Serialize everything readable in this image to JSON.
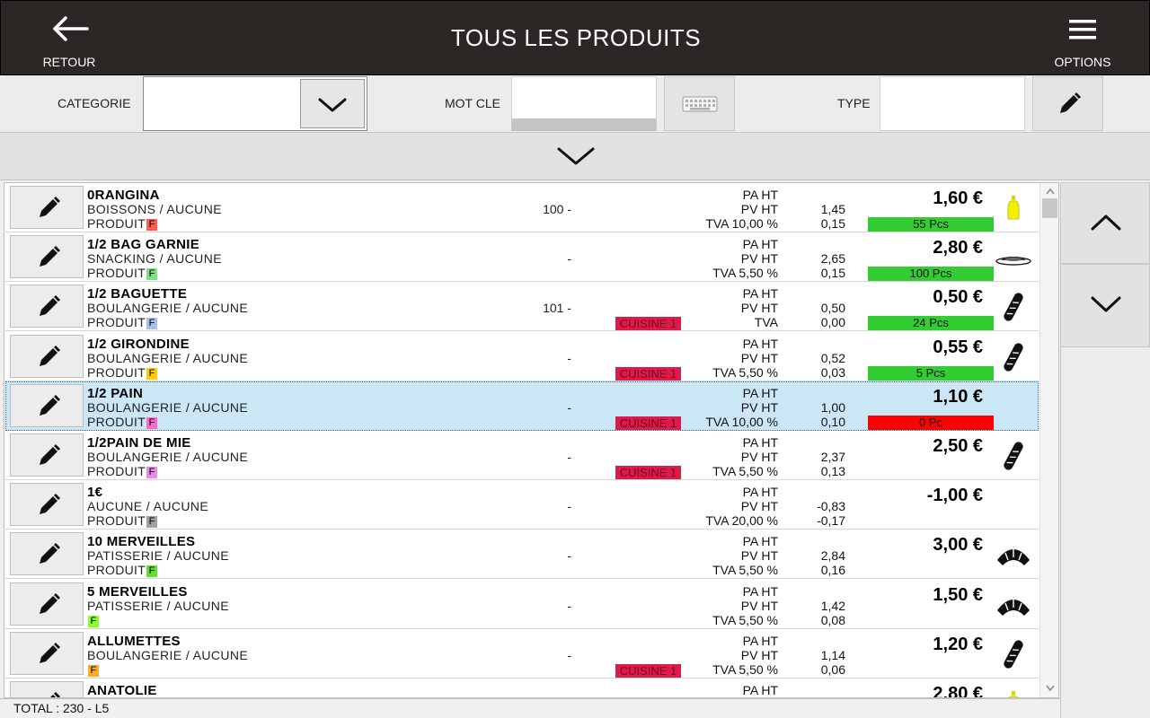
{
  "header": {
    "title": "TOUS LES PRODUITS",
    "back_label": "RETOUR",
    "options_label": "OPTIONS"
  },
  "filters": {
    "category_label": "CATEGORIE",
    "category_value": "",
    "keyword_label": "MOT CLE",
    "keyword_value": "",
    "type_label": "TYPE",
    "type_value": ""
  },
  "footer": {
    "total": "TOTAL : 230  - L5"
  },
  "colors": {
    "header_bg": "#2a2725",
    "selected_row": "#cbe6f5",
    "stock_ok": "#33cc33",
    "stock_empty": "#ff0000",
    "cuisine_badge": "#dc1b4a"
  },
  "products": [
    {
      "name": "0RANGINA",
      "category": "BOISSONS  /  AUCUNE",
      "type": "PRODUIT",
      "badge": "F",
      "badge_color": "#ff5a4a",
      "code": "100 -",
      "cuisine": "",
      "pa_label": "PA HT",
      "pv_label": "PV HT",
      "pv": "1,45",
      "tva_label": "TVA 10,00 %",
      "tva": "0,15",
      "price": "1,60 €",
      "stock": "55 Pcs",
      "stock_color": "#33cc33",
      "icon": "bottle-icon"
    },
    {
      "name": "1/2 BAG GARNIE",
      "category": "SNACKING  /  AUCUNE",
      "type": "PRODUIT",
      "badge": "F",
      "badge_color": "#7ee07e",
      "code": "-",
      "cuisine": "",
      "pa_label": "PA HT",
      "pv_label": "PV HT",
      "pv": "2,65",
      "tva_label": "TVA 5,50 %",
      "tva": "0,15",
      "price": "2,80 €",
      "stock": "100 Pcs",
      "stock_color": "#33cc33",
      "icon": "plate-icon"
    },
    {
      "name": "1/2 BAGUETTE",
      "category": "BOULANGERIE  /  AUCUNE",
      "type": "PRODUIT",
      "badge": "F",
      "badge_color": "#a8c0e8",
      "code": "101 -",
      "cuisine": "CUISINE 1",
      "pa_label": "PA HT",
      "pv_label": "PV HT",
      "pv": "0,50",
      "tva_label": "TVA",
      "tva": "0,00",
      "price": "0,50 €",
      "stock": "24 Pcs",
      "stock_color": "#33cc33",
      "icon": "baguette-icon"
    },
    {
      "name": "1/2 GIRONDINE",
      "category": "BOULANGERIE  /  AUCUNE",
      "type": "PRODUIT",
      "badge": "F",
      "badge_color": "#ffcc00",
      "code": "-",
      "cuisine": "CUISINE 1",
      "pa_label": "PA HT",
      "pv_label": "PV HT",
      "pv": "0,52",
      "tva_label": "TVA 5,50 %",
      "tva": "0,03",
      "price": "0,55 €",
      "stock": "5 Pcs",
      "stock_color": "#33cc33",
      "icon": "baguette-icon"
    },
    {
      "name": "1/2 PAIN",
      "category": "BOULANGERIE  /  AUCUNE",
      "type": "PRODUIT",
      "badge": "F",
      "badge_color": "#ff66cc",
      "code": "-",
      "cuisine": "CUISINE 1",
      "pa_label": "PA HT",
      "pv_label": "PV HT",
      "pv": "1,00",
      "tva_label": "TVA 10,00 %",
      "tva": "0,10",
      "price": "1,10 €",
      "stock": "0 Pc",
      "stock_color": "#ff0000",
      "icon": "",
      "selected": true
    },
    {
      "name": "1/2PAIN DE MIE",
      "category": "BOULANGERIE  /  AUCUNE",
      "type": "PRODUIT",
      "badge": "F",
      "badge_color": "#e88ae8",
      "code": "-",
      "cuisine": "CUISINE 1",
      "pa_label": "PA HT",
      "pv_label": "PV HT",
      "pv": "2,37",
      "tva_label": "TVA 5,50 %",
      "tva": "0,13",
      "price": "2,50 €",
      "stock": "",
      "stock_color": "",
      "icon": "baguette-icon"
    },
    {
      "name": "1€",
      "category": "AUCUNE  /  AUCUNE",
      "type": "PRODUIT",
      "badge": "F",
      "badge_color": "#a0a0a0",
      "code": "-",
      "cuisine": "",
      "pa_label": "PA HT",
      "pv_label": "PV HT",
      "pv": "-0,83",
      "tva_label": "TVA 20,00 %",
      "tva": "-0,17",
      "price": "-1,00 €",
      "stock": "",
      "stock_color": "",
      "icon": ""
    },
    {
      "name": "10 MERVEILLES",
      "category": "PATISSERIE  /  AUCUNE",
      "type": "PRODUIT",
      "badge": "F",
      "badge_color": "#66dd33",
      "code": "-",
      "cuisine": "",
      "pa_label": "PA HT",
      "pv_label": "PV HT",
      "pv": "2,84",
      "tva_label": "TVA 5,50 %",
      "tva": "0,16",
      "price": "3,00 €",
      "stock": "",
      "stock_color": "",
      "icon": "croissant-icon"
    },
    {
      "name": "5 MERVEILLES",
      "category": "PATISSERIE  /  AUCUNE",
      "type": "",
      "badge": "F",
      "badge_color": "#88ff33",
      "code": "-",
      "cuisine": "",
      "pa_label": "PA HT",
      "pv_label": "PV HT",
      "pv": "1,42",
      "tva_label": "TVA 5,50 %",
      "tva": "0,08",
      "price": "1,50 €",
      "stock": "",
      "stock_color": "",
      "icon": "croissant-icon"
    },
    {
      "name": "ALLUMETTES",
      "category": "BOULANGERIE  /  AUCUNE",
      "type": "",
      "badge": "F",
      "badge_color": "#ffaa22",
      "code": "-",
      "cuisine": "CUISINE 1",
      "pa_label": "PA HT",
      "pv_label": "PV HT",
      "pv": "1,14",
      "tva_label": "TVA 5,50 %",
      "tva": "0,06",
      "price": "1,20 €",
      "stock": "",
      "stock_color": "",
      "icon": "baguette-icon"
    },
    {
      "name": "ANATOLIE",
      "category": "",
      "type": "",
      "badge": "",
      "badge_color": "",
      "code": "",
      "cuisine": "",
      "pa_label": "PA HT",
      "pv_label": "",
      "pv": "",
      "tva_label": "",
      "tva": "",
      "price": "2,80 €",
      "stock": "",
      "stock_color": "",
      "icon": "bottle-icon"
    }
  ]
}
